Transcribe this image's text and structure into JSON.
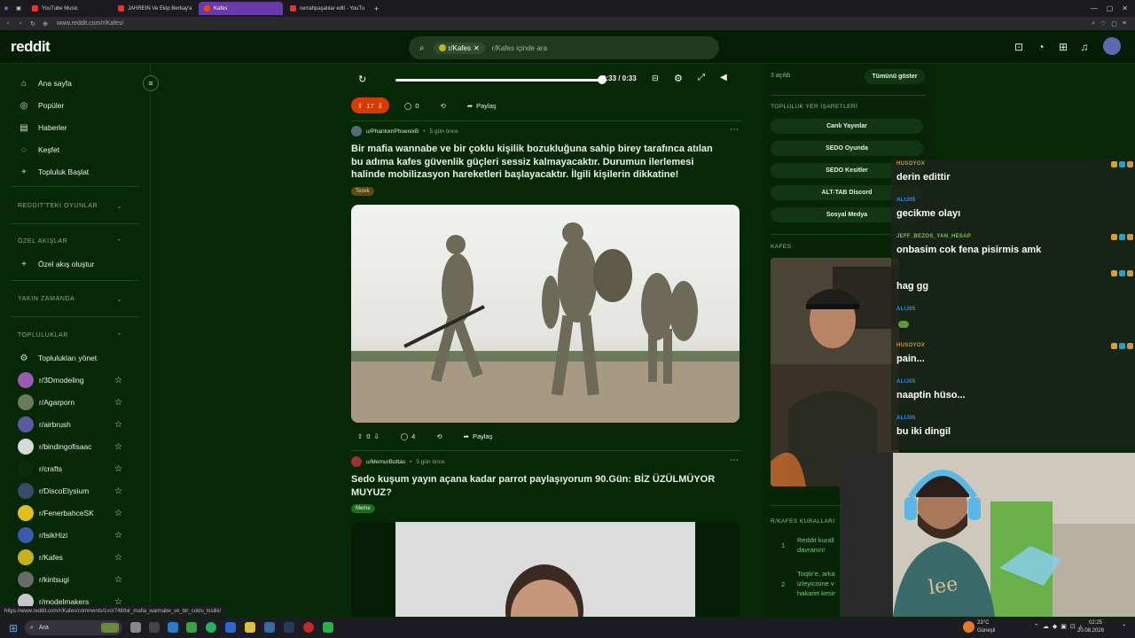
{
  "browser": {
    "tabs": [
      {
        "label": "YouTube Music",
        "active": false
      },
      {
        "label": "JAHREIN Ve Ekip Berkay'a",
        "active": false
      },
      {
        "label": "Kafes",
        "active": true
      },
      {
        "label": "cerrahpaşalılar edit - YouTu",
        "active": false
      }
    ],
    "new_tab": "+",
    "url": "www.reddit.com/r/Kafes/"
  },
  "header": {
    "logo": "reddit",
    "search_chip": "r/Kafes",
    "search_placeholder": "r/Kafes içinde ara"
  },
  "sidebar": {
    "nav": [
      {
        "label": "Ana sayfa",
        "icon": "home-icon"
      },
      {
        "label": "Popüler",
        "icon": "popular-icon"
      },
      {
        "label": "Haberler",
        "icon": "news-icon"
      },
      {
        "label": "Keşfet",
        "icon": "explore-icon"
      },
      {
        "label": "Topluluk Başlat",
        "icon": "plus-icon"
      }
    ],
    "games_heading": "REDDIT'TEKİ OYUNLAR",
    "feeds_heading": "ÖZEL AKIŞLAR",
    "create_feed": "Özel akış oluştur",
    "recent_heading": "YAKIN ZAMANDA",
    "communities_heading": "TOPLULUKLAR",
    "manage_communities": "Toplulukları yönet",
    "communities": [
      "r/3Dmodeling",
      "r/Agarporn",
      "r/airbrush",
      "r/bindingofisaac",
      "r/crafts",
      "r/DiscoElysium",
      "r/FenerbahceSK",
      "r/IsikHizi",
      "r/Kafes",
      "r/kintsugi",
      "r/modelmakers"
    ]
  },
  "video_player": {
    "time": "0:33 / 0:33",
    "progress": 1.0
  },
  "post0_actions": {
    "votes": "17",
    "comments": "0",
    "share": "Paylaş"
  },
  "post1": {
    "user": "u/PhantomPhoenixB",
    "time": "5 gün önce",
    "title": "Bir mafia wannabe ve bir çoklu kişilik bozukluğuna sahip birey tarafınca atılan bu adıma kafes güvenlik güçleri sessiz kalmayacaktır. Durumun ilerlemesi halinde mobilizasyon hareketleri başlayacaktır. İlgili kişilerin dikkatine!",
    "flair": "Tezek",
    "votes": "0",
    "comments": "4",
    "share": "Paylaş"
  },
  "post2": {
    "user": "u/MemurBottas",
    "time": "5 gün önce",
    "title": "Sedo kuşum yayın açana kadar parrot paylaşıyorum 90.Gün: BİZ ÜZÜLMÜYOR MUYUZ?",
    "flair": "Meme"
  },
  "right_sidebar": {
    "online": "3 açıldı",
    "show_all": "Tümünü göster",
    "bookmarks_heading": "TOPLULUK YER İŞARETLERİ",
    "bookmarks": [
      "Canlı Yayınlar",
      "SEDO Oyunda",
      "SEDO Kesitler",
      "ALT-TAB Discord",
      "Sosyal Medya"
    ],
    "kafes_heading": "KAFES",
    "rules_heading": "R/KAFES KURALLARI",
    "rules": [
      {
        "num": "1",
        "text": "Reddit kurall davranın!"
      },
      {
        "num": "2",
        "text": "Toqtir'e, arka izleyicisine v hakaret kesir"
      }
    ]
  },
  "chat": [
    {
      "name": "HUSOYOX",
      "text": "derin edittir",
      "color": "#c89a3c"
    },
    {
      "name": "ALIJ05",
      "text": "gecikme olayı",
      "color": "#3c8ce0"
    },
    {
      "name": "JEFF_BEZOS_YAN_HESAP",
      "text": "onbasim cok fena pisirmis amk",
      "color": "#7ac83c"
    },
    {
      "name": "",
      "text": "hag gg",
      "color": "#3c5ce0"
    },
    {
      "name": "ALIJ05",
      "text": "",
      "color": "#3c8ce0"
    },
    {
      "name": "HUSOYOX",
      "text": "pain...",
      "color": "#c89a3c"
    },
    {
      "name": "ALIJ05",
      "text": "naaptin hüso...",
      "color": "#3c8ce0"
    },
    {
      "name": "ALIJ05",
      "text": "bu iki dingil",
      "color": "#3c8ce0"
    }
  ],
  "status_url": "https://www.reddit.com/r/Kafes/comments/1vor748/bir_mafia_wannabe_ve_bir_coklu_kisilik/",
  "taskbar": {
    "search": "Ara",
    "weather_temp": "23°C",
    "weather_desc": "Güneşli",
    "time": "02:25",
    "date": "20.08.2026"
  },
  "colors": {
    "bg": "#062806",
    "accent": "#d93a00",
    "active_tab": "#6b3aa8"
  }
}
